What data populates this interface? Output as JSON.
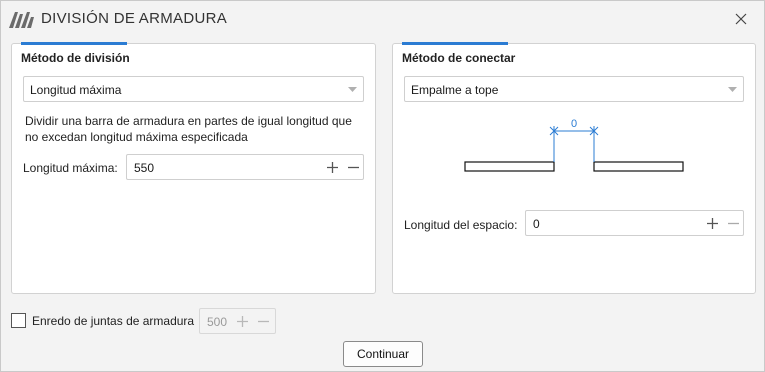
{
  "window": {
    "title": "DIVISIÓN DE ARMADURA"
  },
  "division": {
    "title": "Método de división",
    "method_value": "Longitud máxima",
    "description_line1": "Dividir una barra de armadura en partes de igual longitud que",
    "description_line2": "no excedan longitud máxima especificada",
    "max_length_label": "Longitud máxima:",
    "max_length_value": "550"
  },
  "connect": {
    "title": "Método de conectar",
    "method_value": "Empalme a tope",
    "diagram_gap_label": "0",
    "gap_label": "Longitud del espacio:",
    "gap_value": "0"
  },
  "footer": {
    "checkbox_label": "Enredo de juntas de armadura",
    "checkbox_checked": false,
    "joint_value": "500",
    "continue_label": "Continuar"
  },
  "colors": {
    "accent": "#2b7cd3",
    "dimension": "#2b7cd3"
  }
}
